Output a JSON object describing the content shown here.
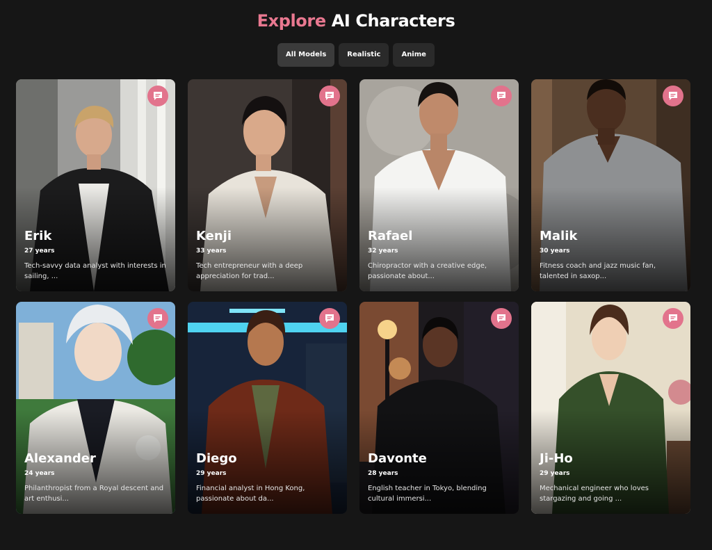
{
  "header": {
    "title_accent": "Explore",
    "title_rest": "AI Characters"
  },
  "colors": {
    "accent": "#e97890",
    "chat_button": "#e2738c",
    "background": "#161616"
  },
  "filters": [
    {
      "label": "All Models",
      "active": true
    },
    {
      "label": "Realistic",
      "active": false
    },
    {
      "label": "Anime",
      "active": false
    }
  ],
  "characters": [
    {
      "name": "Erik",
      "age": "27 years",
      "description": "Tech-savvy data analyst with interests in sailing, ...",
      "style": "realistic"
    },
    {
      "name": "Kenji",
      "age": "33 years",
      "description": "Tech entrepreneur with a deep appreciation for trad...",
      "style": "realistic"
    },
    {
      "name": "Rafael",
      "age": "32 years",
      "description": "Chiropractor with a creative edge, passionate about...",
      "style": "realistic"
    },
    {
      "name": "Malik",
      "age": "30 years",
      "description": "Fitness coach and jazz music fan, talented in saxop...",
      "style": "realistic"
    },
    {
      "name": "Alexander",
      "age": "24 years",
      "description": "Philanthropist from a Royal descent and art enthusi...",
      "style": "anime"
    },
    {
      "name": "Diego",
      "age": "29 years",
      "description": "Financial analyst in Hong Kong, passionate about da...",
      "style": "anime"
    },
    {
      "name": "Davonte",
      "age": "28 years",
      "description": "English teacher in Tokyo, blending cultural immersi...",
      "style": "anime"
    },
    {
      "name": "Ji-Ho",
      "age": "29 years",
      "description": "Mechanical engineer who loves stargazing and going ...",
      "style": "anime"
    }
  ],
  "icons": {
    "chat": "chat-bubble-icon"
  }
}
